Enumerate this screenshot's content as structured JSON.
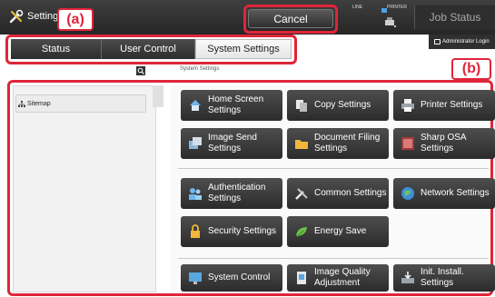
{
  "header": {
    "title": "Settings",
    "cancel_label": "Cancel",
    "job_status_label": "Job Status",
    "status_line_label": "LINE",
    "status_printer_label": "PRINTER",
    "admin_login_label": "Administrator Login"
  },
  "callouts": {
    "a": "(a)",
    "b": "(b)"
  },
  "tabs": [
    {
      "label": "Status"
    },
    {
      "label": "User Control"
    },
    {
      "label": "System Settings"
    }
  ],
  "breadcrumb": "System Settings",
  "sidebar": {
    "sitemap_label": "Sitemap"
  },
  "buttons": [
    {
      "label": "Home Screen Settings",
      "icon": "home-icon"
    },
    {
      "label": "Copy Settings",
      "icon": "copy-icon"
    },
    {
      "label": "Printer Settings",
      "icon": "printer-icon"
    },
    {
      "label": "Image Send Settings",
      "icon": "image-send-icon"
    },
    {
      "label": "Document Filing Settings",
      "icon": "folder-icon"
    },
    {
      "label": "Sharp OSA Settings",
      "icon": "osa-icon"
    },
    {
      "label": "Authentication Settings",
      "icon": "users-icon"
    },
    {
      "label": "Common Settings",
      "icon": "tools-icon"
    },
    {
      "label": "Network Settings",
      "icon": "globe-icon"
    },
    {
      "label": "Security Settings",
      "icon": "lock-icon"
    },
    {
      "label": "Energy Save",
      "icon": "leaf-icon"
    },
    {
      "label": "System Control",
      "icon": "monitor-icon"
    },
    {
      "label": "Image Quality Adjustment",
      "icon": "image-quality-icon"
    },
    {
      "label": "Init. Install. Settings",
      "icon": "install-icon"
    }
  ],
  "colors": {
    "callout": "#e0253a",
    "button_bg": "#3a3a3a",
    "topbar_bg": "#333333"
  }
}
